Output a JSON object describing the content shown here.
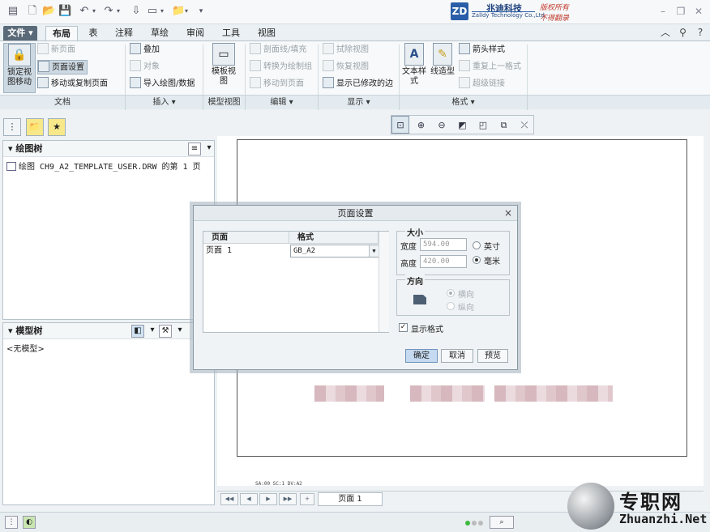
{
  "titlebar": {
    "logo_mark": "ZD",
    "logo_cn": "兆迪科技",
    "logo_en": "Zalldy Technology Co.,Ltd.",
    "copyright_1": "版权所有",
    "copyright_2": "不得翻录"
  },
  "tabs": [
    {
      "label": "文件 ▾"
    },
    {
      "label": "布局"
    },
    {
      "label": "表"
    },
    {
      "label": "注释"
    },
    {
      "label": "草绘"
    },
    {
      "label": "审阅"
    },
    {
      "label": "工具"
    },
    {
      "label": "视图"
    }
  ],
  "ribbon": {
    "lock_view": "锁定视图移动",
    "new_page": "新页面",
    "page_setup": "页面设置",
    "move_copy_page": "移动或复制页面",
    "overlay": "叠加",
    "object": "对象",
    "import_drawing": "导入绘图/数据",
    "template_view": "模板视图",
    "section_fill": "剖面线/填充",
    "convert_to_drawing": "转换为绘制组",
    "move_to_page": "移动到页面",
    "erase_view": "拭除视图",
    "restore_view": "恢复视图",
    "show_modified_edges": "显示已修改的边",
    "text_style": "文本样式",
    "line_style": "线造型",
    "arrow_style": "箭头样式",
    "repeat_last_format": "重复上一格式",
    "hyperlink": "超级链接",
    "groups": [
      "文档",
      "插入 ▾",
      "模型视图",
      "编辑 ▾",
      "显示 ▾",
      "格式 ▾"
    ]
  },
  "left": {
    "draw_tree_title": "绘图树",
    "draw_tree_item": "绘图 CH9_A2_TEMPLATE_USER.DRW 的第 1 页",
    "model_tree_title": "模型树",
    "model_tree_empty": "<无模型>"
  },
  "canvas": {
    "tiny_text": "SA:00  SC:1  DV:A2"
  },
  "pagenav": {
    "page_tab": "页面 1"
  },
  "watermark": {
    "cn": "专职网",
    "en": "Zhuanzhi.Net"
  },
  "dialog": {
    "title": "页面设置",
    "close": "×",
    "col_page": "页面",
    "col_format": "格式",
    "row_page": "页面 1",
    "row_format": "GB_A2",
    "size_legend": "大小",
    "width_label": "宽度",
    "width_value": "594.00",
    "height_label": "高度",
    "height_value": "420.00",
    "unit_inch": "英寸",
    "unit_mm": "毫米",
    "orient_legend": "方向",
    "landscape": "横向",
    "portrait": "纵向",
    "show_format": "显示格式",
    "ok": "确定",
    "cancel": "取消",
    "preview": "预览"
  }
}
